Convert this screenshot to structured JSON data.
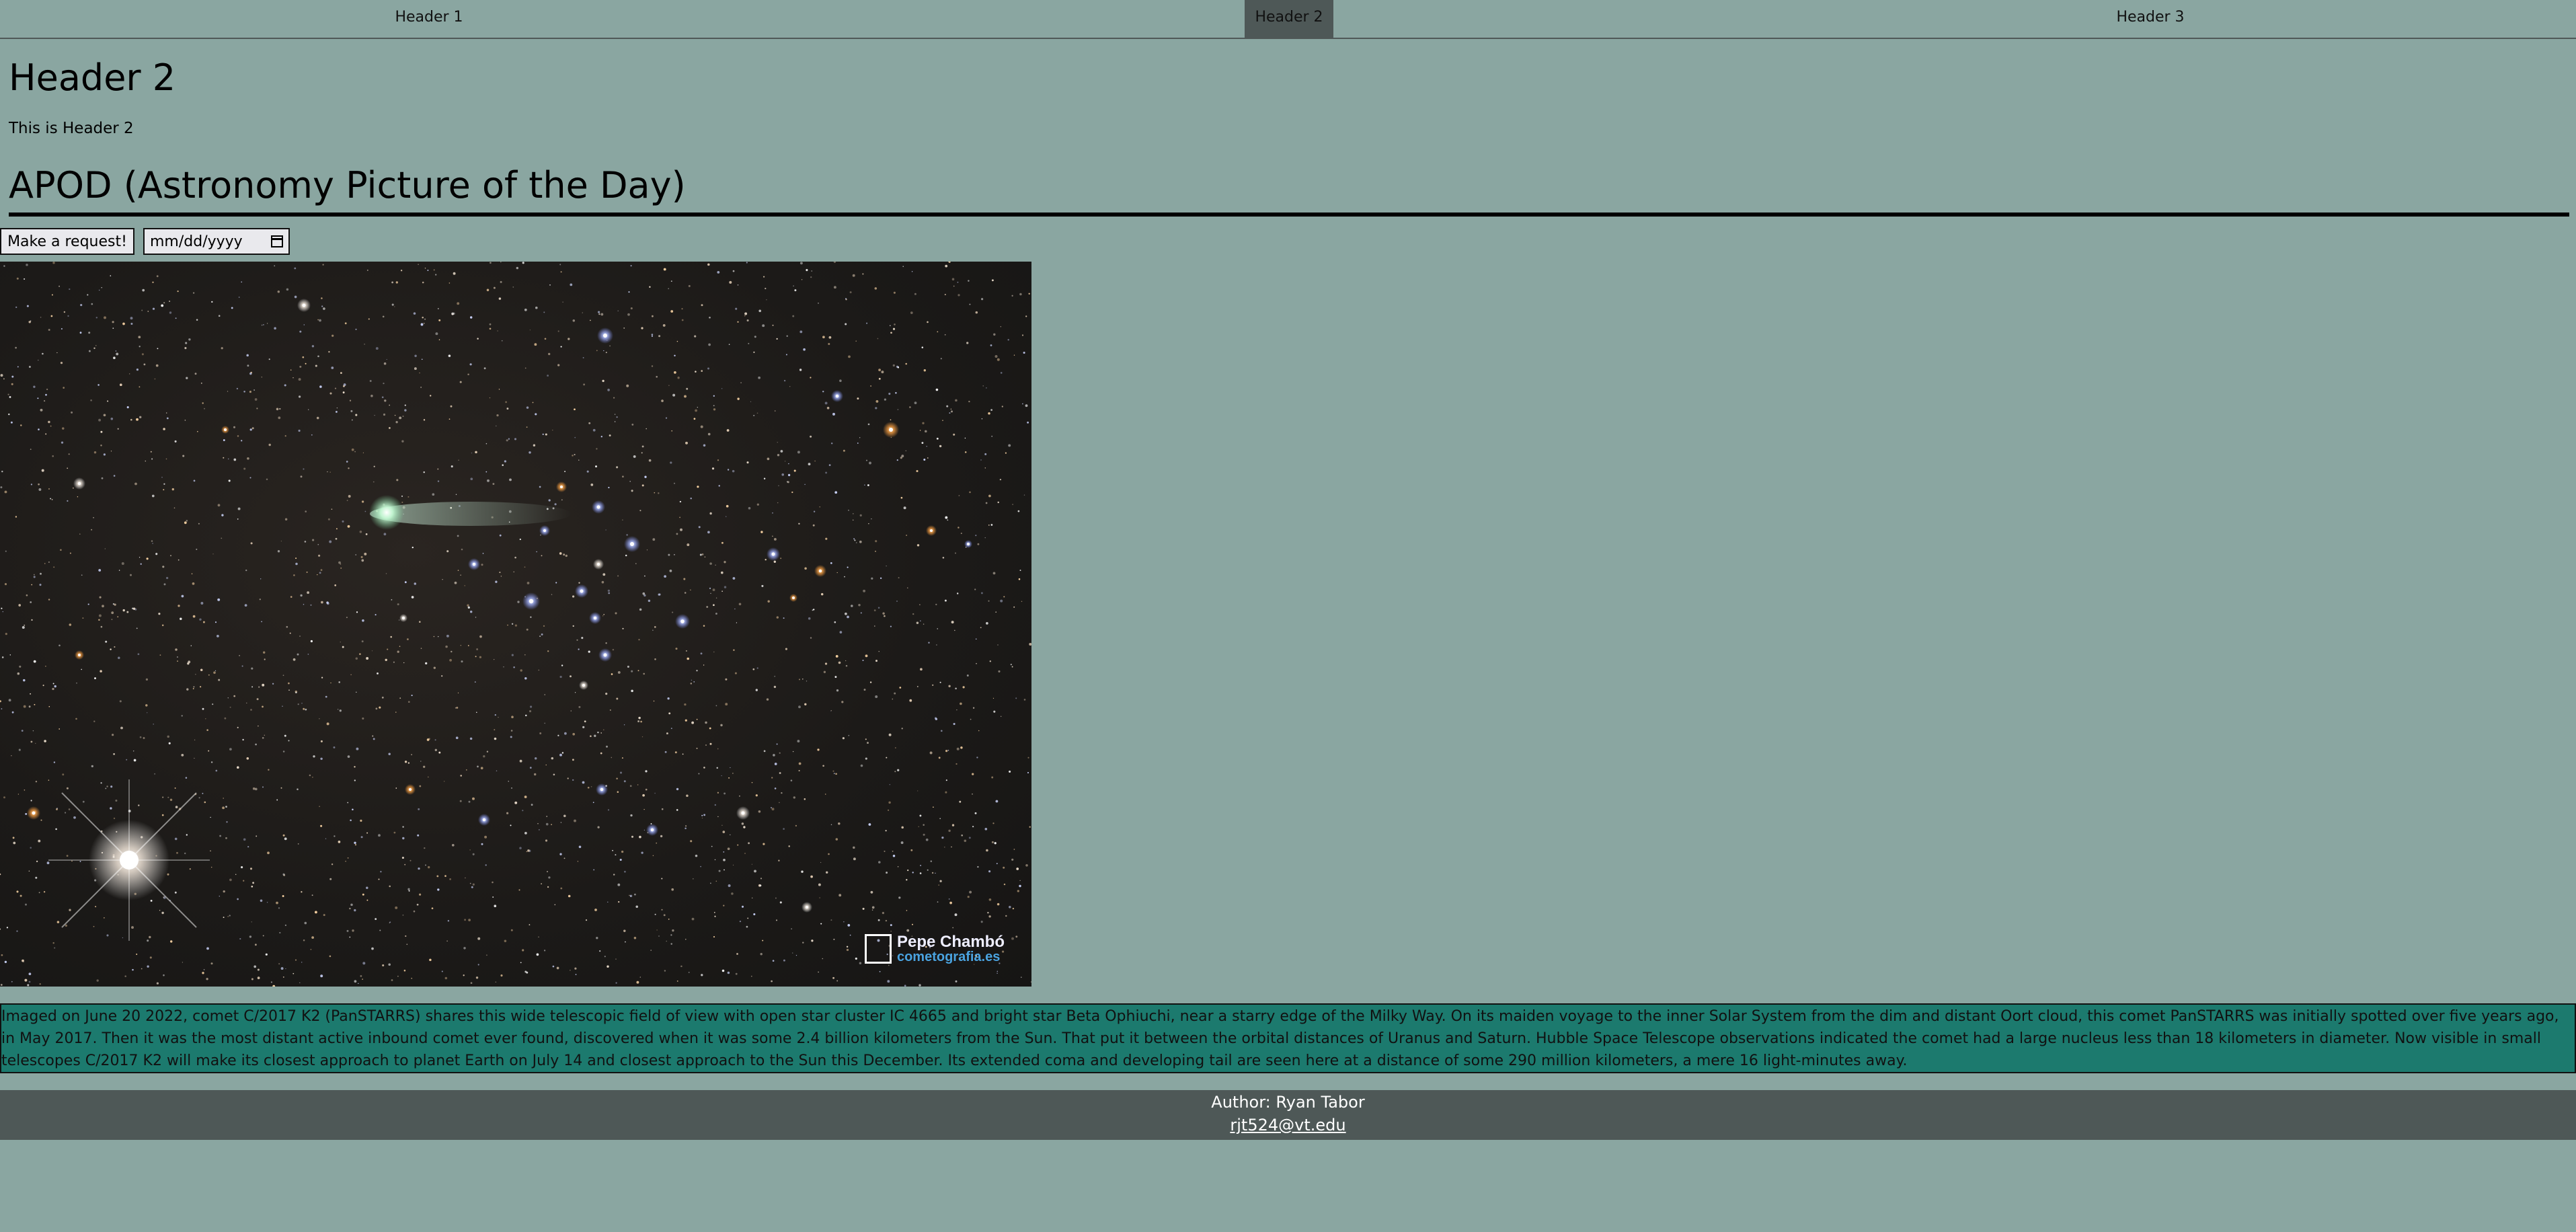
{
  "nav": {
    "items": [
      "Header 1",
      "Header 2",
      "Header 3"
    ],
    "active": "Header 2"
  },
  "page": {
    "title": "Header 2",
    "intro": "This is Header 2",
    "section_title": "APOD (Astronomy Picture of the Day)"
  },
  "controls": {
    "request_button": "Make a request!",
    "date_placeholder": "mm/dd/yyyy"
  },
  "image": {
    "watermark_name": "Pepe Chambó",
    "watermark_site": "cometografia.es"
  },
  "explanation": "Imaged on June 20 2022, comet C/2017 K2 (PanSTARRS) shares this wide telescopic field of view with open star cluster IC 4665 and bright star Beta Ophiuchi, near a starry edge of the Milky Way. On its maiden voyage to the inner Solar System from the dim and distant Oort cloud, this comet PanSTARRS was initially spotted over five years ago, in May 2017. Then it was the most distant active inbound comet ever found, discovered when it was some 2.4 billion kilometers from the Sun. That put it between the orbital distances of Uranus and Saturn. Hubble Space Telescope observations indicated the comet had a large nucleus less than 18 kilometers in diameter. Now visible in small telescopes C/2017 K2 will make its closest approach to planet Earth on July 14 and closest approach to the Sun this December. Its extended coma and developing tail are seen here at a distance of some 290 million kilometers, a mere 16 light-minutes away.",
  "footer": {
    "author": "Author: Ryan Tabor",
    "email": "rjt524@vt.edu"
  },
  "colors": {
    "background": "#8aa6a1",
    "nav_active": "#4e5857",
    "explanation_bg": "#1c7a6e",
    "footer_bg": "#4e5857"
  }
}
